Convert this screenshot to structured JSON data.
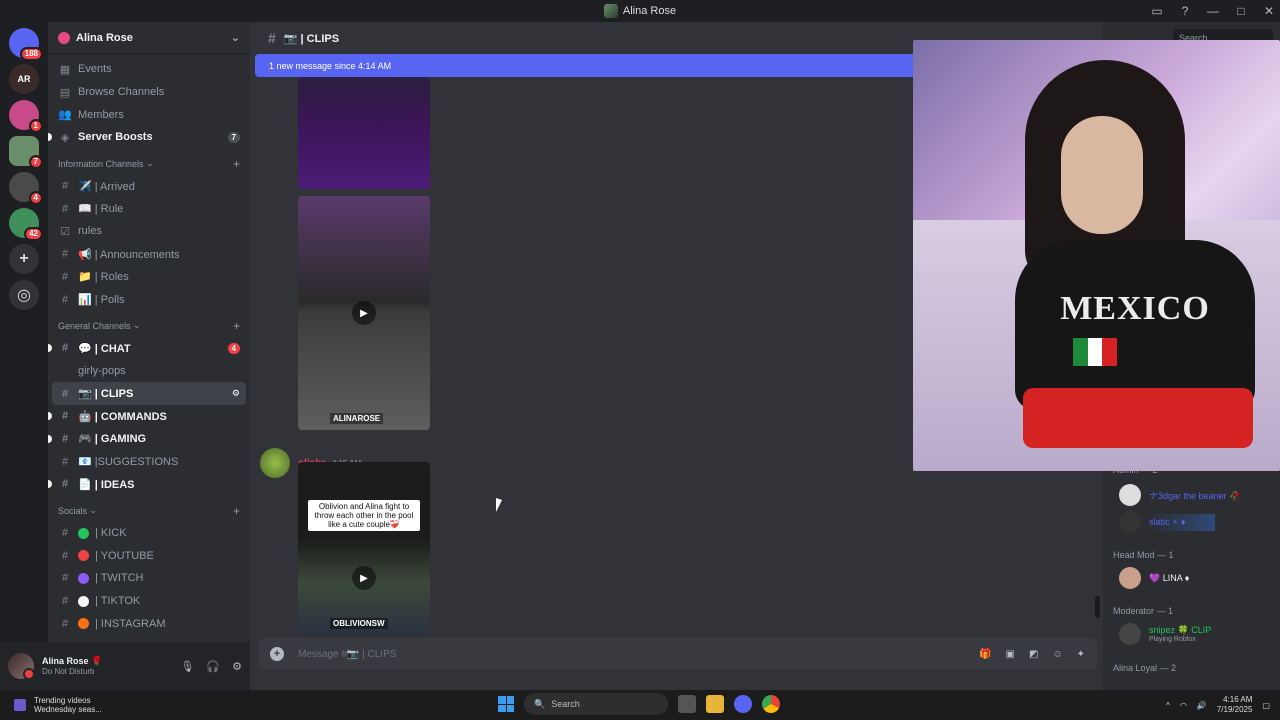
{
  "window": {
    "title": "Alina Rose"
  },
  "servers": [
    {
      "label": "",
      "badge": "188",
      "color": "#5865f2"
    },
    {
      "label": "AR",
      "badge": "",
      "color": "#3a2a2a"
    },
    {
      "label": "",
      "badge": "1",
      "color": "#c94a8a"
    },
    {
      "label": "",
      "badge": "7",
      "color": "#6a8f6a"
    },
    {
      "label": "",
      "badge": "4",
      "color": "#4a4a4a"
    },
    {
      "label": "",
      "badge": "42",
      "color": "#3f8f5a"
    }
  ],
  "guild": {
    "name": "Alina Rose"
  },
  "sidebar": {
    "top_items": [
      {
        "label": "Events",
        "icon": "calendar-icon"
      },
      {
        "label": "Browse Channels",
        "icon": "browse-icon"
      },
      {
        "label": "Members",
        "icon": "members-icon"
      },
      {
        "label": "Server Boosts",
        "icon": "boost-icon",
        "count": "7"
      }
    ],
    "categories": [
      {
        "name": "Information Channels",
        "channels": [
          {
            "label": "✈️ | Arrived"
          },
          {
            "label": "📖 | Rule"
          },
          {
            "label": "rules"
          },
          {
            "label": "📢 | Announcements"
          },
          {
            "label": "📁 | Roles"
          },
          {
            "label": "📊 | Polls"
          }
        ]
      },
      {
        "name": "General Channels",
        "channels": [
          {
            "label": "💬 | CHAT",
            "count": "4"
          },
          {
            "label": "girly-pops"
          },
          {
            "label": "📷 | CLIPS"
          },
          {
            "label": "🤖 | COMMANDS"
          },
          {
            "label": "🎮 | GAMING"
          },
          {
            "label": "📧 |SUGGESTIONS"
          },
          {
            "label": "📄 | IDEAS"
          }
        ]
      },
      {
        "name": "Socials",
        "channels": [
          {
            "label": "| KICK",
            "color": "#22c55e"
          },
          {
            "label": "| YOUTUBE",
            "color": "#ef4444"
          },
          {
            "label": "| TWITCH",
            "color": "#8b5cf6"
          },
          {
            "label": "| TIKTOK",
            "color": "#f5f5f5"
          },
          {
            "label": "| INSTAGRAM",
            "color": "#f97316"
          }
        ]
      }
    ]
  },
  "user": {
    "name": "Alina Rose 🌹",
    "status": "Do Not Disturb"
  },
  "channel": {
    "name": "📷 | CLIPS"
  },
  "banner": {
    "text": "1 new message since 4:14 AM"
  },
  "message": {
    "author": "slicks",
    "time": "4:15 AM",
    "clip_caption": "Oblivion and Alina fight to throw each other in the pool like a cute couple❤️‍🩹",
    "clip_tag": "OBLIVIONSW"
  },
  "clip2_tag": "ALINAROSE",
  "composer": {
    "placeholder": "Message #📷 | CLIPS"
  },
  "members_panel": {
    "search_placeholder": "Search",
    "groups": [
      {
        "title": "Admin — 2",
        "members": [
          {
            "name": "ナ3dgar the beaner 🥀",
            "color": "#5865f2"
          },
          {
            "name": "slatic ⚡ ♦",
            "color": "#5865f2"
          }
        ]
      },
      {
        "title": "Head Mod — 1",
        "members": [
          {
            "name": "💜 LINA ♦",
            "color": "#f2f3f5"
          }
        ]
      },
      {
        "title": "Moderator — 1",
        "members": [
          {
            "name": "snipez 🍀 CLIP",
            "color": "#22c55e",
            "sub": "Playing Roblox"
          }
        ]
      },
      {
        "title": "Alina Loyal — 2",
        "members": []
      }
    ]
  },
  "stream": {
    "shirt_text": "MEXICO"
  },
  "taskbar": {
    "news_title": "Trending videos",
    "news_sub": "Wednesday seas...",
    "search_placeholder": "Search",
    "time": "4:16 AM",
    "date": "7/19/2025"
  }
}
